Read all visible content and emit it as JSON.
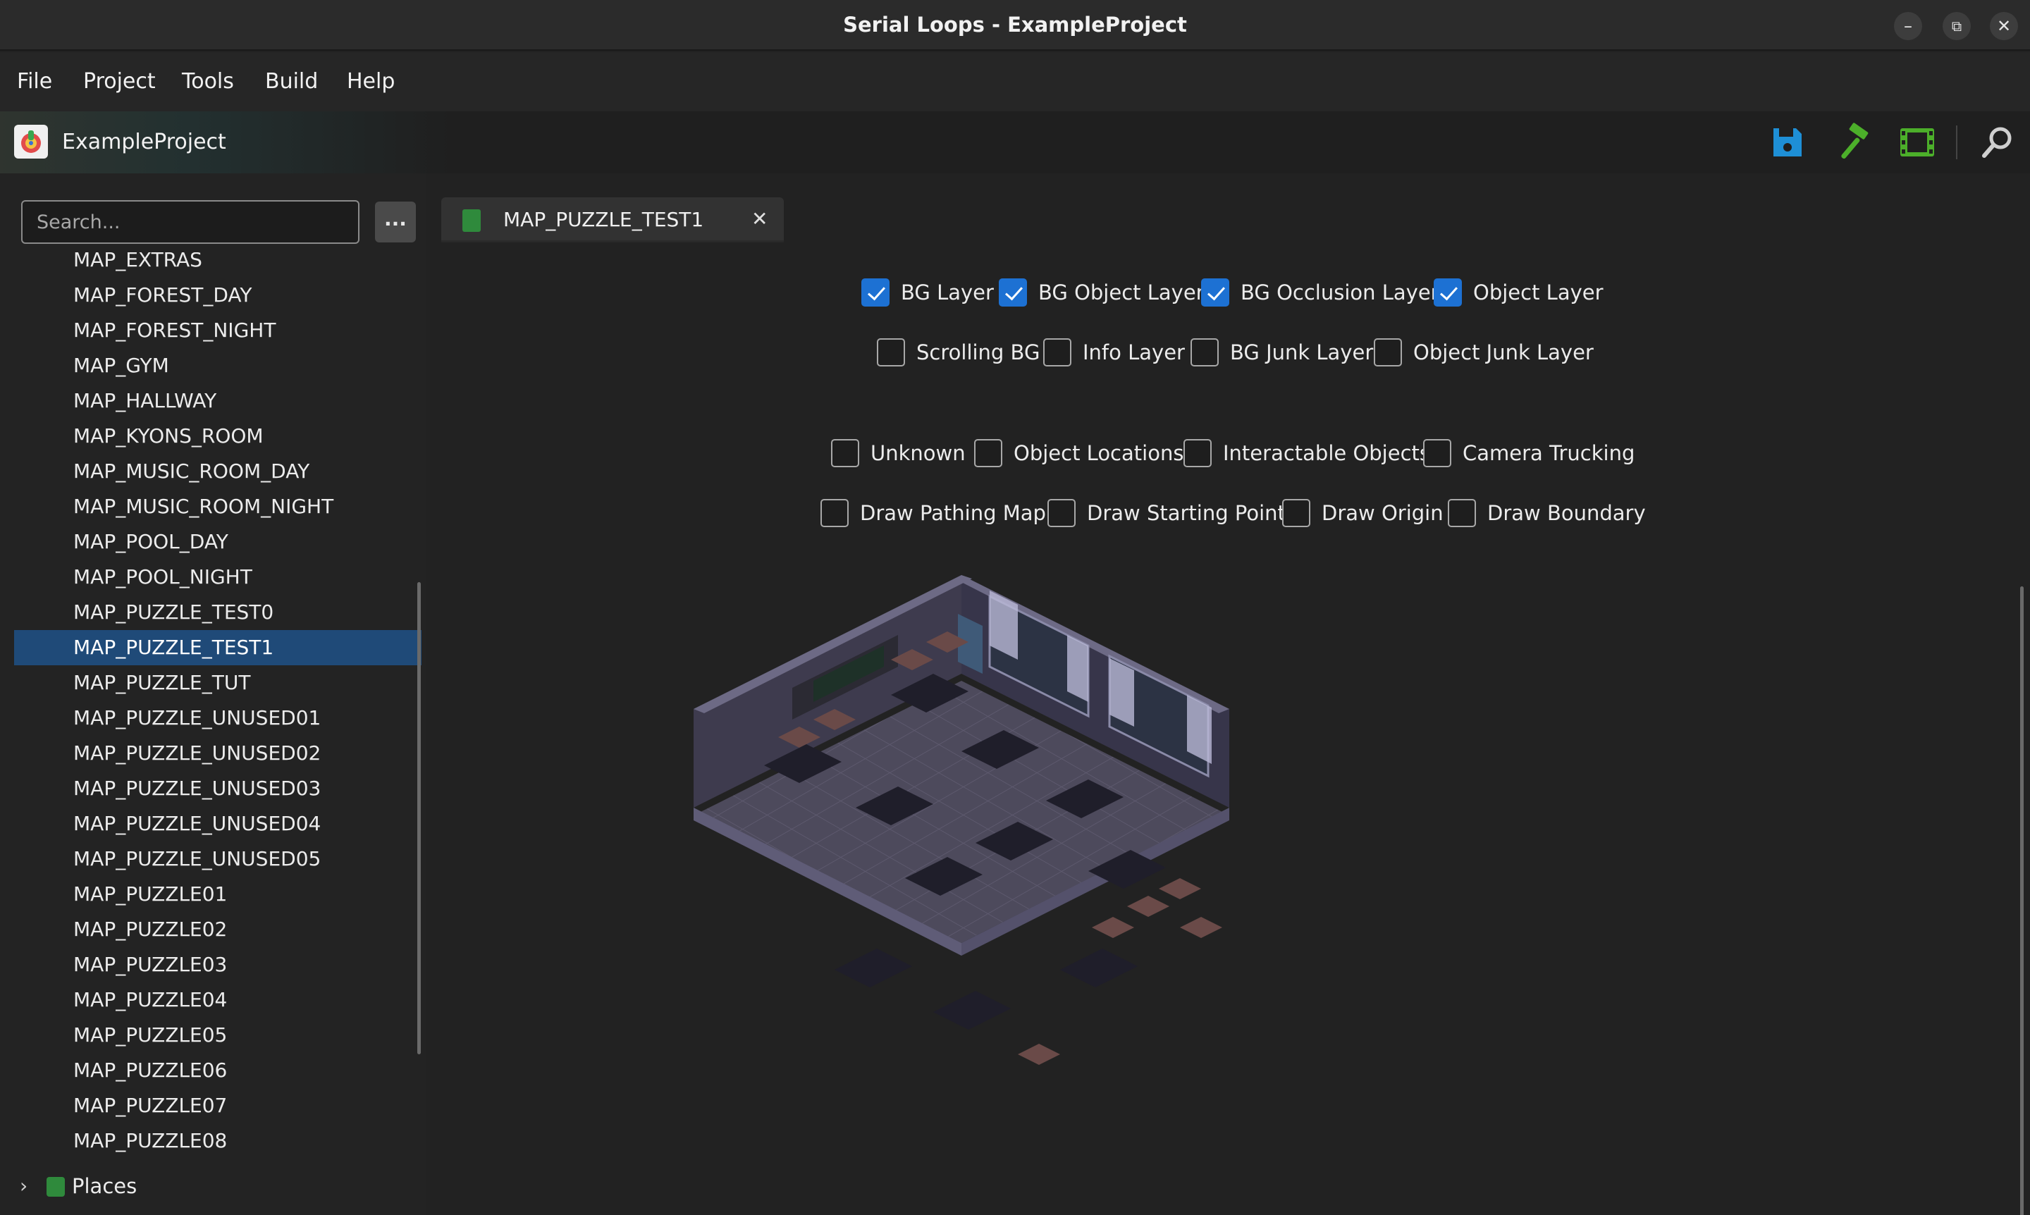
{
  "window": {
    "title": "Serial Loops - ExampleProject",
    "minimize_glyph": "–",
    "maximize_glyph": "⧉",
    "close_glyph": "✕"
  },
  "menu": {
    "items": [
      "File",
      "Project",
      "Tools",
      "Build",
      "Help"
    ]
  },
  "toolbar": {
    "project_name": "ExampleProject",
    "icons": [
      "save-icon",
      "build-hammer-icon",
      "run-film-icon",
      "search-icon"
    ],
    "colors": {
      "save": "#1e8fd6",
      "build": "#4caf2a",
      "run": "#4caf2a",
      "search": "#cfcfcf"
    }
  },
  "sidebar": {
    "search_placeholder": "Search...",
    "more_label": "...",
    "items": [
      "MAP_EXTRAS",
      "MAP_FOREST_DAY",
      "MAP_FOREST_NIGHT",
      "MAP_GYM",
      "MAP_HALLWAY",
      "MAP_KYONS_ROOM",
      "MAP_MUSIC_ROOM_DAY",
      "MAP_MUSIC_ROOM_NIGHT",
      "MAP_POOL_DAY",
      "MAP_POOL_NIGHT",
      "MAP_PUZZLE_TEST0",
      "MAP_PUZZLE_TEST1",
      "MAP_PUZZLE_TUT",
      "MAP_PUZZLE_UNUSED01",
      "MAP_PUZZLE_UNUSED02",
      "MAP_PUZZLE_UNUSED03",
      "MAP_PUZZLE_UNUSED04",
      "MAP_PUZZLE_UNUSED05",
      "MAP_PUZZLE01",
      "MAP_PUZZLE02",
      "MAP_PUZZLE03",
      "MAP_PUZZLE04",
      "MAP_PUZZLE05",
      "MAP_PUZZLE06",
      "MAP_PUZZLE07",
      "MAP_PUZZLE08"
    ],
    "selected_item": "MAP_PUZZLE_TEST1",
    "places_label": "Places",
    "selected_color": "#1f4a78"
  },
  "editor": {
    "tab_label": "MAP_PUZZLE_TEST1",
    "tab_close": "✕",
    "layers_row1": [
      {
        "label": "BG Layer",
        "checked": true
      },
      {
        "label": "BG Object Layer",
        "checked": true
      },
      {
        "label": "BG Occlusion Layer",
        "checked": true
      },
      {
        "label": "Object Layer",
        "checked": true
      }
    ],
    "layers_row2": [
      {
        "label": "Scrolling BG",
        "checked": false
      },
      {
        "label": "Info Layer",
        "checked": false
      },
      {
        "label": "BG Junk Layer",
        "checked": false
      },
      {
        "label": "Object Junk Layer",
        "checked": false
      }
    ],
    "overlays_row1": [
      {
        "label": "Unknown",
        "checked": false
      },
      {
        "label": "Object Locations",
        "checked": false
      },
      {
        "label": "Interactable Objects",
        "checked": false
      },
      {
        "label": "Camera Trucking",
        "checked": false
      }
    ],
    "overlays_row2": [
      {
        "label": "Draw Pathing Map",
        "checked": false
      },
      {
        "label": "Draw Starting Point",
        "checked": false
      },
      {
        "label": "Draw Origin",
        "checked": false
      },
      {
        "label": "Draw Boundary",
        "checked": false
      }
    ],
    "checkbox_accent": "#1d71d3"
  }
}
